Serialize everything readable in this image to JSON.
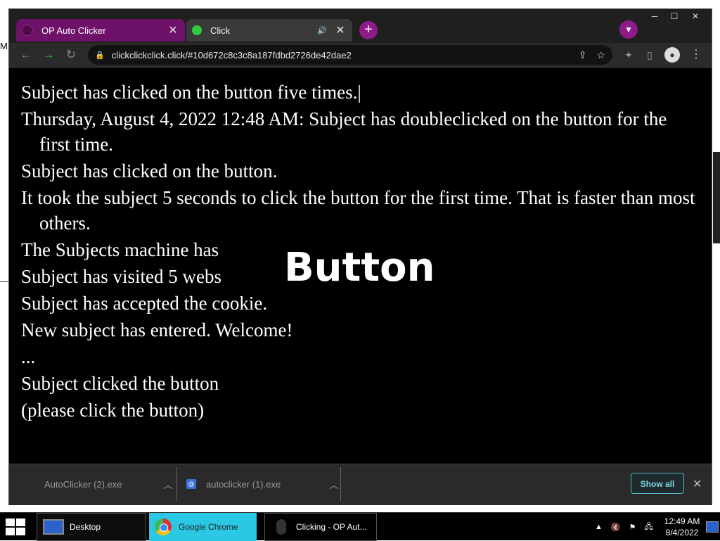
{
  "desktop": {
    "left_letter": "M"
  },
  "browser": {
    "tabs": [
      {
        "title": "OP Auto Clicker",
        "active": false
      },
      {
        "title": "Click",
        "active": true
      }
    ],
    "new_tab": "+",
    "tab_search_icon": "chevron-down-icon",
    "window_controls": {
      "minimize": "─",
      "maximize": "☐",
      "close": "✕"
    },
    "nav": {
      "back": "←",
      "forward": "→",
      "reload": "↻"
    },
    "url": "clickclickclick.click/#10d672c8c3c8a187fdbd2726de42dae2"
  },
  "page": {
    "log_lines": [
      "Subject has clicked on the button five times.|",
      "Thursday, August 4, 2022 12:48 AM: Subject has doubleclicked on the button for the first time.",
      "Subject has clicked on the button.",
      "It took the subject 5 seconds to click the button for the first time. That is faster than most others.",
      "The Subjects machine has",
      "Subject has visited 5 webs",
      "Subject has accepted the cookie.",
      "New subject has entered. Welcome!",
      "...",
      "Subject clicked the button",
      "(please click the button)"
    ],
    "button_label": "Button"
  },
  "downloads": {
    "items": [
      {
        "name": "AutoClicker (2).exe"
      },
      {
        "name": "autoclicker (1).exe"
      }
    ],
    "show_all": "Show all",
    "close": "✕"
  },
  "taskbar": {
    "items": [
      {
        "label": "Desktop"
      },
      {
        "label": "Google Chrome"
      },
      {
        "label": "Clicking - OP Aut..."
      }
    ],
    "tray_arrow": "▲",
    "time": "12:49 AM",
    "date": "8/4/2022"
  },
  "colors": {
    "tab_active_accent": "#6e1169",
    "plus_button": "#8e1b88",
    "forward_arrow": "#2ecc40",
    "show_all_border": "#53b8c6",
    "chrome_taskbar_highlight": "#2bc8e3"
  }
}
